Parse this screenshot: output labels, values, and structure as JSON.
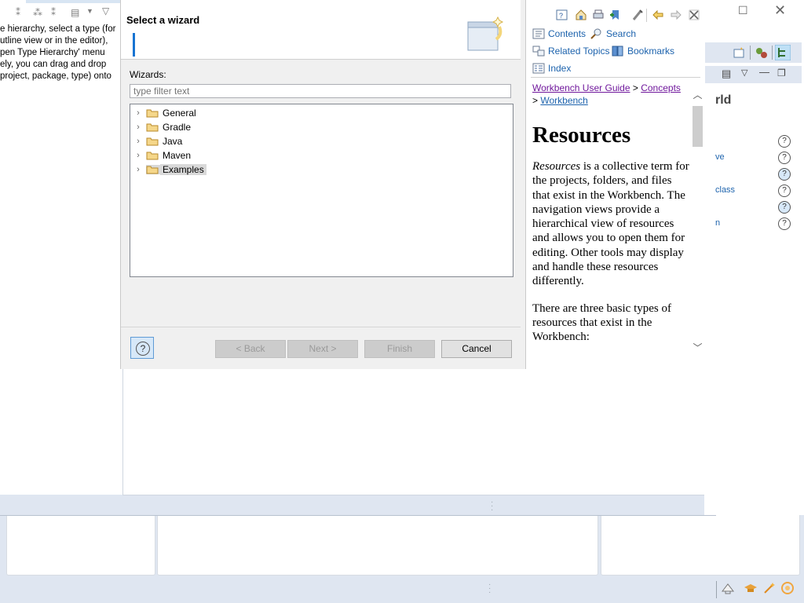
{
  "background": {
    "left_panel_text": [
      "e hierarchy, select a type (for",
      "utline view or in the editor),",
      "pen Type Hierarchy' menu",
      "ely, you can drag and drop",
      "project, package, type) onto"
    ],
    "right_title_fragment": "rld",
    "right_links": [
      "ve",
      "class",
      "n"
    ]
  },
  "wizard": {
    "title": "Select a wizard",
    "wizards_label": "Wizards:",
    "filter_placeholder": "type filter text",
    "tree_items": [
      {
        "label": "General",
        "selected": false
      },
      {
        "label": "Gradle",
        "selected": false
      },
      {
        "label": "Java",
        "selected": false
      },
      {
        "label": "Maven",
        "selected": false
      },
      {
        "label": "Examples",
        "selected": true
      }
    ],
    "buttons": {
      "back": "< Back",
      "next": "Next >",
      "finish": "Finish",
      "cancel": "Cancel"
    }
  },
  "help": {
    "nav": {
      "contents": "Contents",
      "search": "Search",
      "related_topics": "Related Topics",
      "bookmarks": "Bookmarks",
      "index": "Index"
    },
    "breadcrumb": {
      "guide": "Workbench User Guide",
      "sep": ">",
      "concepts": "Concepts",
      "workbench": "Workbench"
    },
    "heading": "Resources",
    "para1_em": "Resources",
    "para1_rest": " is a collective term for the projects, folders, and files that exist in the Workbench. The navigation views provide a hierarchical view of resources and allows you to open them for editing. Other tools may display and handle these resources differently.",
    "para2": "There are three basic types of resources that exist in the Workbench:"
  },
  "colors": {
    "accent": "#1874d2",
    "status_bar": "#dfe6f1",
    "visited_link": "#70189c",
    "link": "#1d63ad"
  }
}
